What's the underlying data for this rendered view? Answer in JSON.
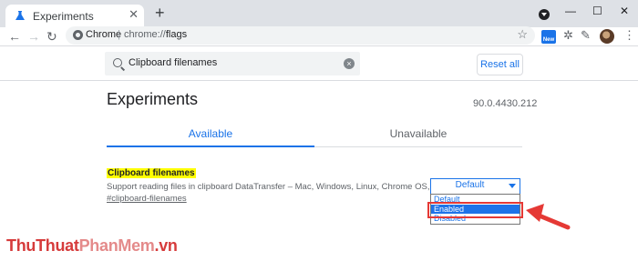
{
  "tab": {
    "title": "Experiments",
    "close": "✕"
  },
  "window": {
    "newtab": "+",
    "minimize": "—",
    "maximize": "☐",
    "close": "✕"
  },
  "toolbar": {
    "back": "←",
    "forward": "→",
    "reload": "↻",
    "omnibox_site": "Chrome",
    "omnibox_sep": "|",
    "omnibox_scheme": "chrome://",
    "omnibox_path": "flags",
    "star": "☆",
    "ext_badge": "New",
    "puzzle": "✲",
    "pen": "✎",
    "menu": "⋮"
  },
  "search": {
    "value": "Clipboard filenames",
    "clear": "×"
  },
  "reset_label": "Reset all",
  "page": {
    "title": "Experiments",
    "version": "90.0.4430.212"
  },
  "tabs": [
    {
      "label": "Available"
    },
    {
      "label": "Unavailable"
    }
  ],
  "flag": {
    "name": "Clipboard filenames",
    "description": "Support reading files in clipboard DataTransfer – Mac, Windows, Linux, Chrome OS, Android",
    "link": "#clipboard-filenames",
    "selected": "Default",
    "options": [
      "Default",
      "Enabled",
      "Disabled"
    ]
  },
  "watermark": {
    "part1": "ThuThuat",
    "part2": "PhanMem",
    "part3": ".vn"
  },
  "colors": {
    "accent": "#1a73e8",
    "highlight": "#ffff00",
    "annotation": "#e53935"
  }
}
